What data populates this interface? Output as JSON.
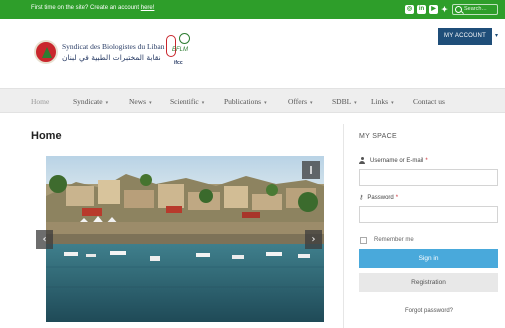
{
  "topbar": {
    "message": "First time on the site? Create an account ",
    "link": "here!",
    "search_placeholder": "Search…",
    "social_icons": [
      "instagram-icon",
      "linkedin-icon",
      "youtube-icon",
      "twitter-icon"
    ]
  },
  "header": {
    "brand_fr": "Syndicat des Biologistes du Liban",
    "brand_ar": "نقابة المختبرات الطبية في لبنان",
    "partner_text_top": "EFLM",
    "partner_text_bottom": "ifcc",
    "account_button": "MY ACCOUNT"
  },
  "nav": {
    "items": [
      {
        "label": "Home",
        "dropdown": false
      },
      {
        "label": "Syndicate",
        "dropdown": true
      },
      {
        "label": "News",
        "dropdown": true
      },
      {
        "label": "Scientific",
        "dropdown": true
      },
      {
        "label": "Publications",
        "dropdown": true
      },
      {
        "label": "Offers",
        "dropdown": true
      },
      {
        "label": "SDBL",
        "dropdown": true
      },
      {
        "label": "Links",
        "dropdown": true
      },
      {
        "label": "Contact us",
        "dropdown": false
      }
    ]
  },
  "main": {
    "title": "Home",
    "slider": {
      "pause_symbol": "‖",
      "prev_symbol": "‹",
      "next_symbol": "›"
    }
  },
  "sidebar": {
    "title": "MY SPACE",
    "username_label": "Username or E-mail",
    "password_label": "Password",
    "required_mark": "*",
    "remember_label": "Remember me",
    "signin_button": "Sign in",
    "registration_button": "Registration",
    "forgot_link": "Forgot password?"
  },
  "colors": {
    "topbar_green": "#2e9e2a",
    "account_blue": "#1f4e79",
    "signin_blue": "#49a9db",
    "nav_bg": "#eeeeee"
  }
}
